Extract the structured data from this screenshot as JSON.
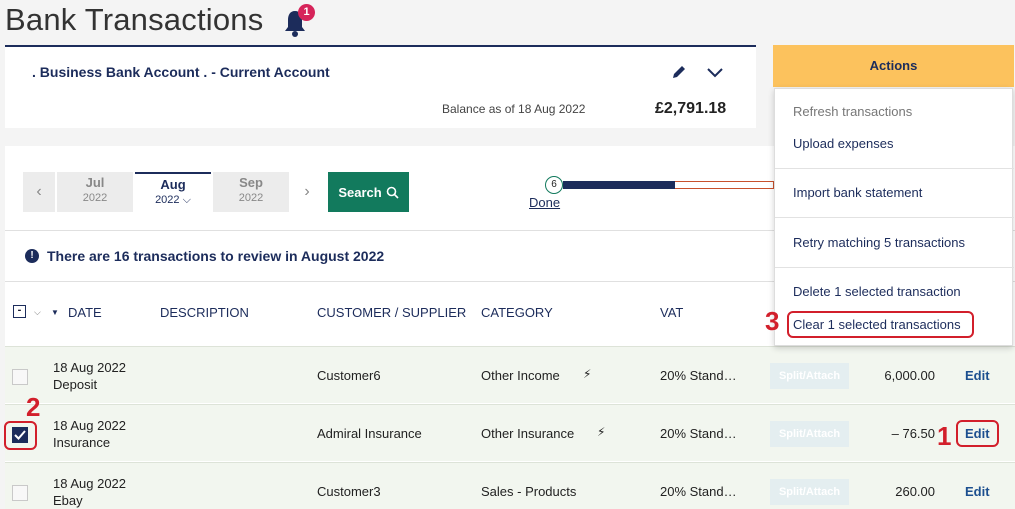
{
  "page": {
    "title": "Bank Transactions",
    "notification_count": "1"
  },
  "account": {
    "name": ". Business Bank Account . - Current Account",
    "balance_label": "Balance as of 18 Aug 2022",
    "balance_value": "£2,791.18"
  },
  "month_nav": {
    "prev_arrow": "‹",
    "next_arrow": "›",
    "months": [
      {
        "month": "Jul",
        "year": "2022"
      },
      {
        "month": "Aug",
        "year": "2022 ⌵"
      },
      {
        "month": "Sep",
        "year": "2022"
      }
    ],
    "search_label": "Search"
  },
  "progress": {
    "step": "6",
    "link_label": "Done",
    "fill_fraction": 0.53
  },
  "review_message": "There are 16 transactions to review in August 2022",
  "table": {
    "columns": {
      "date": "DATE",
      "description": "DESCRIPTION",
      "customer": "CUSTOMER / SUPPLIER",
      "category": "CATEGORY",
      "vat": "VAT"
    },
    "rows": [
      {
        "date": "18 Aug 2022",
        "type": "Deposit",
        "customer": "Customer6",
        "category": "Other Income",
        "vat": "20% Stand…",
        "split_label": "Split/Attach",
        "amount": "6,000.00",
        "edit_label": "Edit",
        "checked": false
      },
      {
        "date": "18 Aug 2022",
        "type": "Insurance",
        "customer": "Admiral Insurance",
        "category": "Other Insurance",
        "vat": "20% Stand…",
        "split_label": "Split/Attach",
        "amount": "– 76.50",
        "edit_label": "Edit",
        "checked": true
      },
      {
        "date": "18 Aug 2022",
        "type": "Ebay",
        "customer": "Customer3",
        "category": "Sales - Products",
        "vat": "20% Stand…",
        "split_label": "Split/Attach",
        "amount": "260.00",
        "edit_label": "Edit",
        "checked": false
      }
    ]
  },
  "actions": {
    "button_label": "Actions",
    "items": [
      "Refresh transactions",
      "Upload expenses",
      "Import bank statement",
      "Retry matching 5 transactions",
      "Delete 1 selected transaction",
      "Clear 1 selected transactions"
    ]
  },
  "annotations": {
    "one": "1",
    "two": "2",
    "three": "3",
    "color": "#d21f2b"
  },
  "colors": {
    "navy": "#1c2c5b",
    "green": "#127a5d",
    "actions_yellow": "#fcc25d",
    "badge_pink": "#d6245a"
  }
}
